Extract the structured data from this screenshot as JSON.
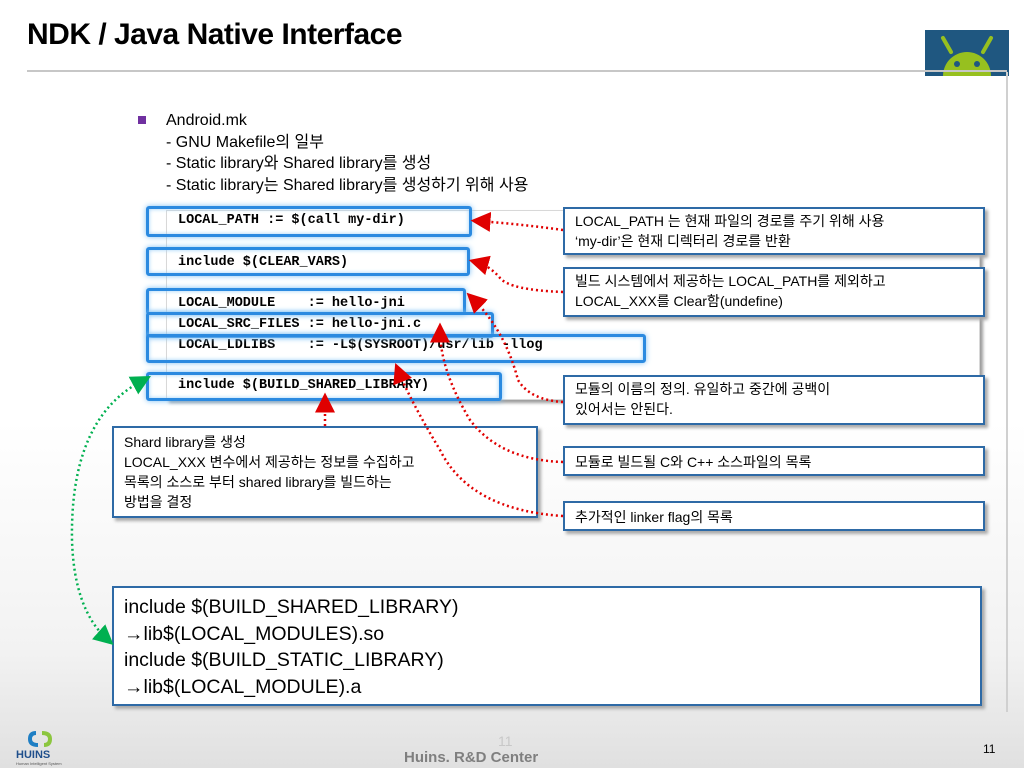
{
  "slide": {
    "title": "NDK / Java Native Interface",
    "page_number": "11",
    "ghost_page_number": "11",
    "footer": "Huins. R&D Center",
    "logo_text": "HUINS",
    "logo_tagline": "Human Intelligent System"
  },
  "bullet": {
    "lines": [
      "Android.mk",
      "- GNU Makefile의 일부",
      "- Static library와 Shared library를 생성",
      "- Static library는 Shared library를 생성하기 위해 사용"
    ]
  },
  "code": {
    "lines": [
      "LOCAL_PATH := $(call my-dir)",
      "include $(CLEAR_VARS)",
      "LOCAL_MODULE    := hello-jni",
      "LOCAL_SRC_FILES := hello-jni.c",
      "LOCAL_LDLIBS    := -L$(SYSROOT)/usr/lib -llog",
      "include $(BUILD_SHARED_LIBRARY)"
    ]
  },
  "notes": {
    "local_path": [
      "LOCAL_PATH 는 현재 파일의 경로를 주기 위해 사용",
      "‘my-dir’은 현재 디렉터리 경로를 반환"
    ],
    "clear_vars": [
      "빌드 시스템에서 제공하는 LOCAL_PATH를 제외하고",
      "LOCAL_XXX를 Clear함(undefine)"
    ],
    "module": [
      "모듈의 이름의 정의. 유일하고 중간에 공백이",
      "있어서는 안된다."
    ],
    "src_files": [
      "모듈로 빌드될 C와 C++ 소스파일의 목록"
    ],
    "ldlibs": [
      "추가적인 linker flag의 목록"
    ],
    "shared": [
      "Shard library를 생성",
      "LOCAL_XXX 변수에서 제공하는 정보를 수집하고",
      "목록의 소스로 부터 shared library를 빌드하는",
      "방법을 결정"
    ]
  },
  "summary": {
    "lines": [
      "include $(BUILD_SHARED_LIBRARY)",
      "→lib$(LOCAL_MODULES).so",
      "include $(BUILD_STATIC_LIBRARY)",
      "→lib$(LOCAL_MODULE).a"
    ]
  },
  "colors": {
    "bullet": "#7030a0",
    "highlight": "#2b8ae0",
    "arrow_red": "#e00000",
    "arrow_green": "#00b050",
    "box_border": "#2e6aa6"
  }
}
